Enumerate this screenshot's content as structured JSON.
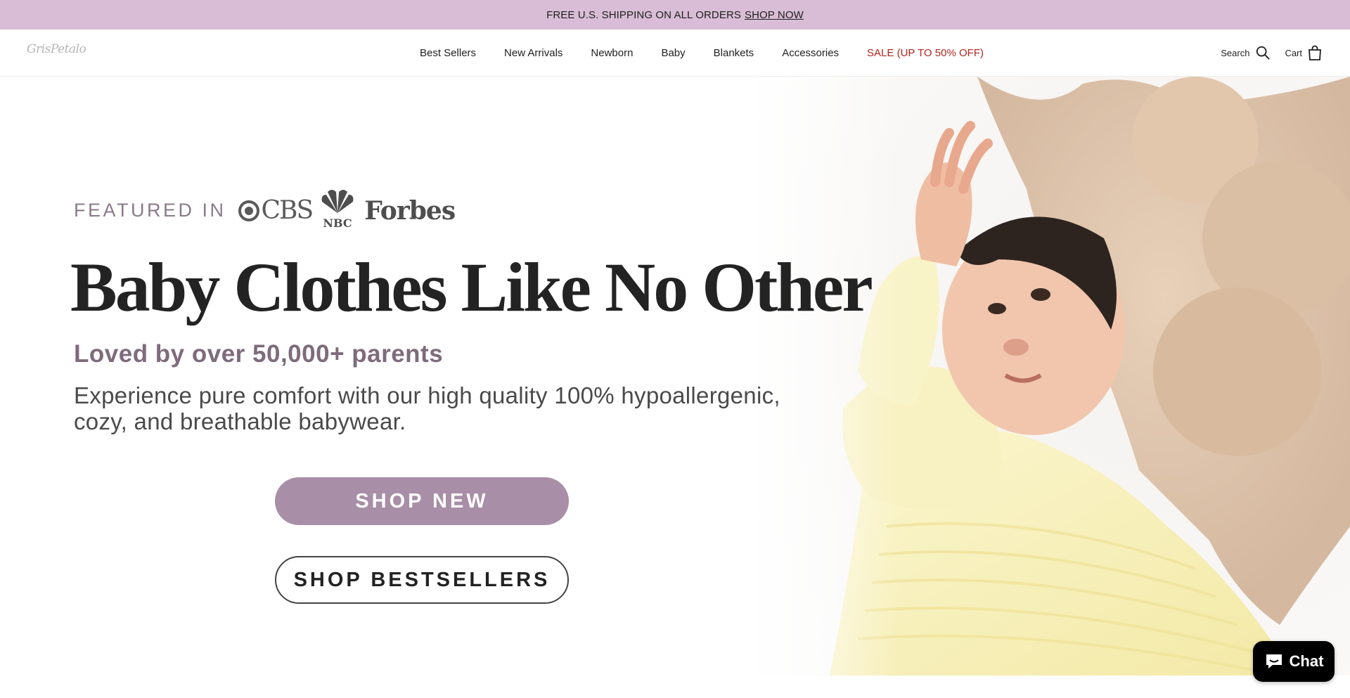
{
  "announcement": {
    "text": "FREE U.S. SHIPPING ON ALL ORDERS",
    "link": "SHOP NOW"
  },
  "header": {
    "logo": "GrisPetalo",
    "nav": [
      {
        "label": "Best Sellers"
      },
      {
        "label": "New Arrivals"
      },
      {
        "label": "Newborn"
      },
      {
        "label": "Baby"
      },
      {
        "label": "Blankets"
      },
      {
        "label": "Accessories"
      },
      {
        "label": "SALE (UP TO 50% OFF)"
      }
    ],
    "search_label": "Search",
    "cart_label": "Cart"
  },
  "hero": {
    "featured_label": "FEATURED IN",
    "featured_logos": [
      "CBS",
      "NBC",
      "Forbes"
    ],
    "headline": "Baby Clothes Like No Other",
    "subheadline": "Loved by over 50,000+ parents",
    "description_line1": "Experience pure comfort with our high quality 100% hypoallergenic,",
    "description_line2": "cozy, and breathable babywear.",
    "btn_primary": "SHOP NEW",
    "btn_secondary": "SHOP BESTSELLERS"
  },
  "chat": {
    "label": "Chat"
  },
  "colors": {
    "announcement_bg": "#d9bdd6",
    "sale": "#b3261e",
    "primary_button": "#a88ea7",
    "subheadline": "#7e6b7c"
  }
}
